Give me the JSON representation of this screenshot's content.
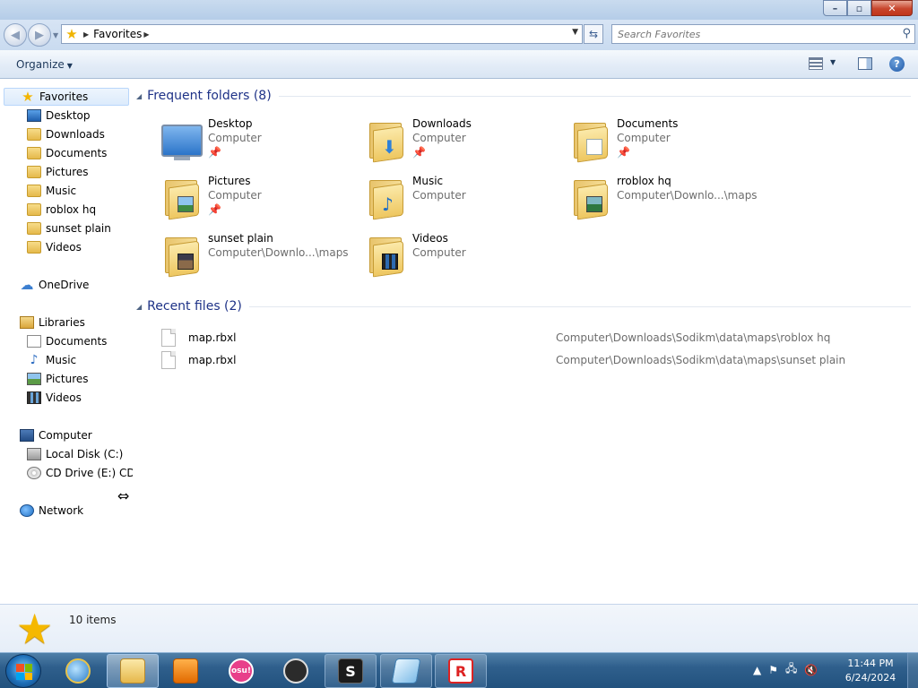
{
  "window": {
    "controls": {
      "minimize": "–",
      "maximize": "▫",
      "close": "✕"
    }
  },
  "address": {
    "location": "Favorites",
    "search_placeholder": "Search Favorites"
  },
  "command_bar": {
    "organize_label": "Organize",
    "help_label": "?"
  },
  "nav": {
    "favorites": {
      "label": "Favorites",
      "items": [
        "Desktop",
        "Downloads",
        "Documents",
        "Pictures",
        "Music",
        "roblox hq",
        "sunset plain",
        "Videos"
      ]
    },
    "onedrive": "OneDrive",
    "libraries": {
      "label": "Libraries",
      "items": [
        "Documents",
        "Music",
        "Pictures",
        "Videos"
      ]
    },
    "computer": {
      "label": "Computer",
      "items": [
        "Local Disk (C:)",
        "CD Drive (E:) CDR"
      ]
    },
    "network": "Network"
  },
  "content": {
    "frequent_header": "Frequent folders (8)",
    "folders": [
      {
        "name": "Desktop",
        "location": "Computer",
        "pinned": true,
        "icon": "desktop-monitor"
      },
      {
        "name": "Downloads",
        "location": "Computer",
        "pinned": true,
        "icon": "downloads-folder"
      },
      {
        "name": "Documents",
        "location": "Computer",
        "pinned": true,
        "icon": "documents-folder"
      },
      {
        "name": "Pictures",
        "location": "Computer",
        "pinned": true,
        "icon": "pictures-folder"
      },
      {
        "name": "Music",
        "location": "Computer",
        "pinned": false,
        "icon": "music-folder"
      },
      {
        "name": "rroblox hq",
        "location": "Computer\\Downlo...\\maps",
        "pinned": false,
        "icon": "map-folder"
      },
      {
        "name": "sunset plain",
        "location": "Computer\\Downlo...\\maps",
        "pinned": false,
        "icon": "sunset-folder"
      },
      {
        "name": "Videos",
        "location": "Computer",
        "pinned": false,
        "icon": "videos-folder"
      }
    ],
    "recent_header": "Recent files (2)",
    "files": [
      {
        "name": "map.rbxl",
        "path": "Computer\\Downloads\\Sodikm\\data\\maps\\roblox hq"
      },
      {
        "name": "map.rbxl",
        "path": "Computer\\Downloads\\Sodikm\\data\\maps\\sunset plain"
      }
    ]
  },
  "details": {
    "item_count": "10 items"
  },
  "taskbar": {
    "apps": [
      "internet-explorer",
      "windows-explorer",
      "media-player",
      "osu",
      "obs-studio",
      "steam",
      "sticky-notes",
      "roblox-studio"
    ],
    "osu_label": "osu!",
    "steam_label": "S",
    "roblox_label": "R",
    "clock_time": "11:44 PM",
    "clock_date": "6/24/2024"
  }
}
